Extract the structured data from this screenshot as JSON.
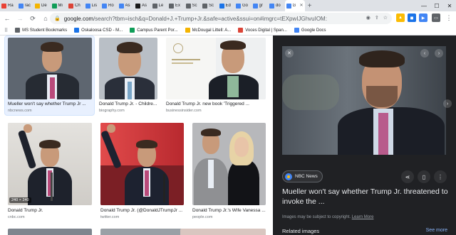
{
  "browser": {
    "tabs": [
      {
        "label": "Ra",
        "color": "#e94235"
      },
      {
        "label": "rac",
        "color": "#4285f4"
      },
      {
        "label": "De",
        "color": "#f4b400"
      },
      {
        "label": "Mi",
        "color": "#0f9d58"
      },
      {
        "label": "Ch",
        "color": "#db4437"
      },
      {
        "label": "Lis",
        "color": "#4285f4"
      },
      {
        "label": "Ro",
        "color": "#4285f4"
      },
      {
        "label": "As",
        "color": "#4285f4"
      },
      {
        "label": "As",
        "color": "#1a1a1a"
      },
      {
        "label": "Le",
        "color": "#5f6368"
      },
      {
        "label": "Ex",
        "color": "#5f6368"
      },
      {
        "label": "Sc",
        "color": "#5f6368"
      },
      {
        "label": "Sc",
        "color": "#5f6368"
      },
      {
        "label": "Ed",
        "color": "#1a73e8"
      },
      {
        "label": "Go",
        "color": "#4285f4"
      },
      {
        "label": "gr",
        "color": "#4285f4"
      },
      {
        "label": "do",
        "color": "#4285f4"
      },
      {
        "label": "G",
        "color": "#4285f4"
      }
    ],
    "active_tab_index": 17,
    "new_tab": "+",
    "minimize": "—",
    "maximize": "☐",
    "close": "✕",
    "url_host": "google.com",
    "url_rest": "/search?tbm=isch&q=Donald+J.+Trump+Jr.&safe=active&ssui=on#imgrc=tEXpwIJGhvuIOM:",
    "bookmarks": [
      {
        "label": "MS Student Bookmarks",
        "color": "#5f6368"
      },
      {
        "label": "Oskaloosa CSD - M...",
        "color": "#1a73e8"
      },
      {
        "label": "Campus Parent Por...",
        "color": "#0f9d58"
      },
      {
        "label": "McDougal Littell: A...",
        "color": "#f4b400"
      },
      {
        "label": "Voces Digital | Span...",
        "color": "#db4437"
      },
      {
        "label": "Google Docs",
        "color": "#4285f4"
      }
    ]
  },
  "results": [
    {
      "caption": "Mueller won't say whether Trump Jr ...",
      "source": "nbcnews.com"
    },
    {
      "caption": "Donald Trump Jr. - Childre...",
      "source": "biography.com"
    },
    {
      "caption": "Donald Trump Jr. new book 'Triggered ...",
      "source": "businessinsider.com"
    },
    {
      "caption": "Donald Trump Jr.",
      "source": "cnbc.com",
      "dims": "240 × 240"
    },
    {
      "caption": "Donald Trump Jr. (@DonaldJTrumpJr ...",
      "source": "twitter.com"
    },
    {
      "caption": "Donald Trump Jr.'s Wife Vanessa ...",
      "source": "people.com"
    }
  ],
  "panel": {
    "source_chip": "NBC News",
    "title": "Mueller won't say whether Trump Jr. threatened to invoke the ...",
    "note": "Images may be subject to copyright.",
    "learn_more": "Learn More",
    "related_label": "Related images",
    "see_more": "See more"
  }
}
